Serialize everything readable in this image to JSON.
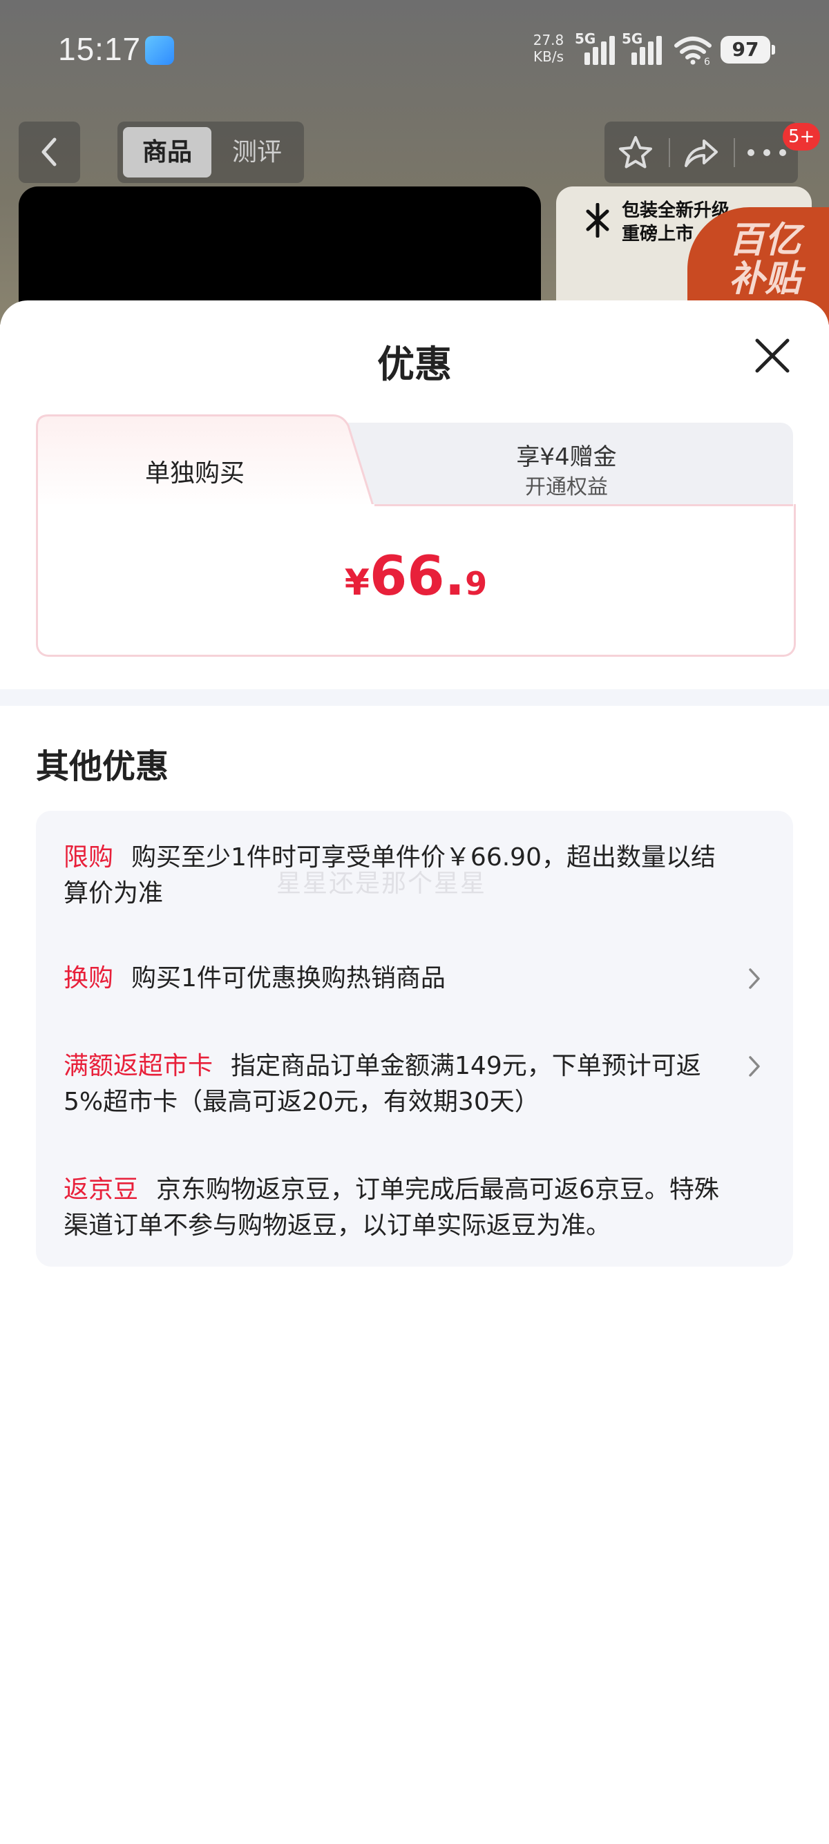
{
  "status_bar": {
    "time": "15:17",
    "speed_value": "27.8",
    "speed_unit": "KB/s",
    "sim1_label": "5G",
    "sim2_label": "5G",
    "wifi_label": "6",
    "battery": "97"
  },
  "background_page": {
    "tabs": [
      "商品",
      "测评"
    ],
    "badge": "5+",
    "promo_line1": "包装全新升级",
    "promo_line2": "重磅上市",
    "subsidy_line1": "百亿",
    "subsidy_line2": "补贴"
  },
  "sheet": {
    "title": "优惠",
    "tab_single": "单独购买",
    "tab_member_line1": "享¥4赠金",
    "tab_member_line2": "开通权益",
    "price_currency": "¥",
    "price_integer": "66.",
    "price_decimal": "9",
    "other_title": "其他优惠",
    "items": [
      {
        "tag": "限购",
        "text": "购买至少1件时可享受单件价￥66.90，超出数量以结算价为准",
        "has_arrow": false
      },
      {
        "tag": "换购",
        "text": "购买1件可优惠换购热销商品",
        "has_arrow": true
      },
      {
        "tag": "满额返超市卡",
        "text": "指定商品订单金额满149元，下单预计可返5%超市卡（最高可返20元，有效期30天）",
        "has_arrow": true
      },
      {
        "tag": "返京豆",
        "text": "京东购物返京豆，订单完成后最高可返6京豆。特殊渠道订单不参与购物返豆，以订单实际返豆为准。",
        "has_arrow": false
      }
    ],
    "watermark": "星星还是那个星星"
  },
  "colors": {
    "accent_red": "#e8203a",
    "list_bg": "#f5f6fa"
  }
}
